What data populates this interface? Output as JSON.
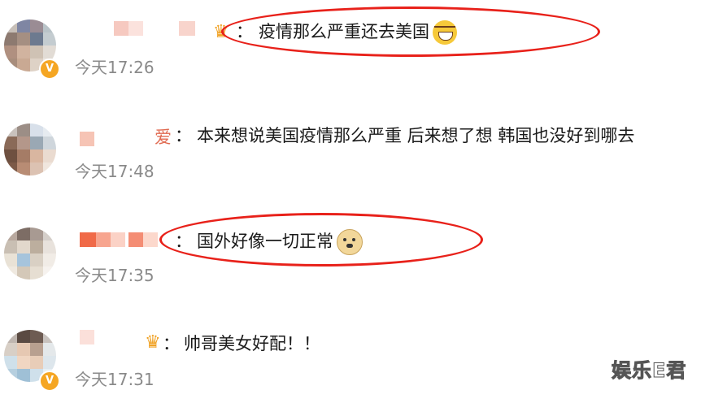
{
  "comments": [
    {
      "text": "疫情那么严重还去美国",
      "emoji": "laugh-cry-emoji",
      "time": "今天17:26",
      "verified": true,
      "name_suffix": "",
      "crown": true
    },
    {
      "text": "本来想说美国疫情那么严重 后来想了想 韩国也没好到哪去",
      "emoji": "",
      "time": "今天17:48",
      "verified": false,
      "name_suffix": "爱",
      "crown": false
    },
    {
      "text": "国外好像一切正常",
      "emoji": "doge-emoji",
      "time": "今天17:35",
      "verified": false,
      "name_suffix": "",
      "crown": false
    },
    {
      "text": "帅哥美女好配！！",
      "emoji": "",
      "time": "今天17:31",
      "verified": true,
      "name_suffix": "",
      "crown": true
    }
  ],
  "colon": "：",
  "verified_badge": "V",
  "watermark": "娱乐E君",
  "colors": {
    "highlight": "#e8211a",
    "time": "#8a8a8a",
    "verified": "#f5a623"
  }
}
